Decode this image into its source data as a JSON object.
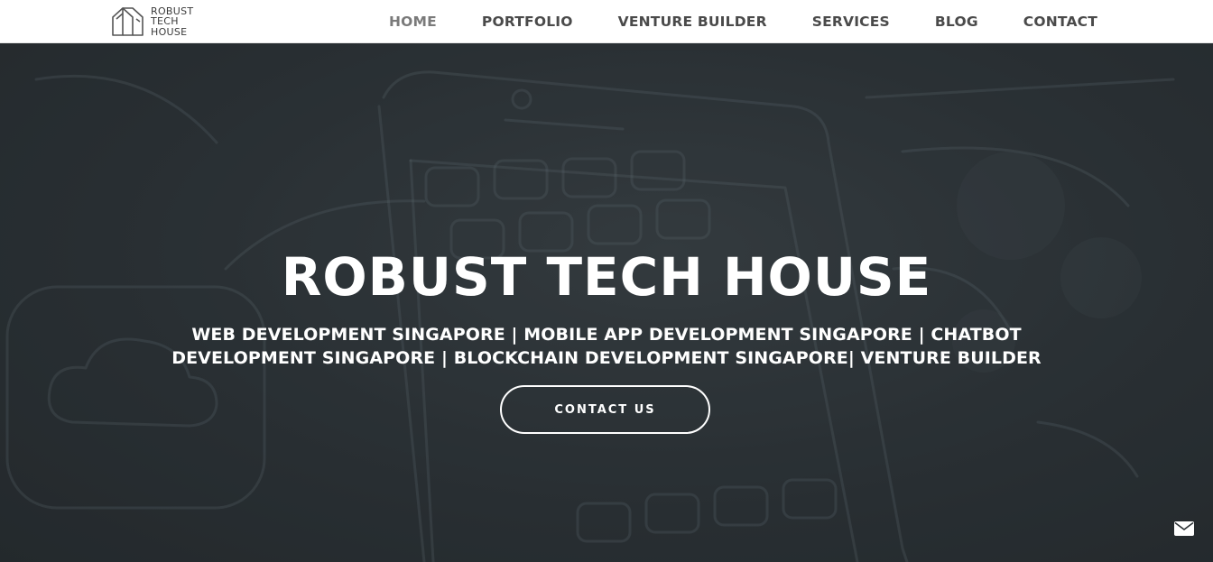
{
  "brand": {
    "logo_lines": [
      "ROBUST",
      "TECH",
      "HOUSE"
    ]
  },
  "nav": {
    "items": [
      {
        "label": "HOME",
        "active": true
      },
      {
        "label": "PORTFOLIO",
        "active": false
      },
      {
        "label": "VENTURE BUILDER",
        "active": false
      },
      {
        "label": "SERVICES",
        "active": false
      },
      {
        "label": "BLOG",
        "active": false
      },
      {
        "label": "CONTACT",
        "active": false
      }
    ]
  },
  "hero": {
    "title": "ROBUST TECH HOUSE",
    "subtitle": "WEB DEVELOPMENT SINGAPORE | MOBILE APP DEVELOPMENT SINGAPORE | CHATBOT DEVELOPMENT SINGAPORE | BLOCKCHAIN DEVELOPMENT SINGAPORE| VENTURE BUILDER",
    "cta_label": "CONTACT US"
  },
  "icons": {
    "logo": "house-outline-logo-icon",
    "floating": "envelope-icon"
  },
  "colors": {
    "navbar_bg": "#ffffff",
    "nav_text": "#4a4a4a",
    "nav_active": "#7a7a7a",
    "hero_bg": "#2b3134",
    "hero_text": "#ffffff"
  }
}
